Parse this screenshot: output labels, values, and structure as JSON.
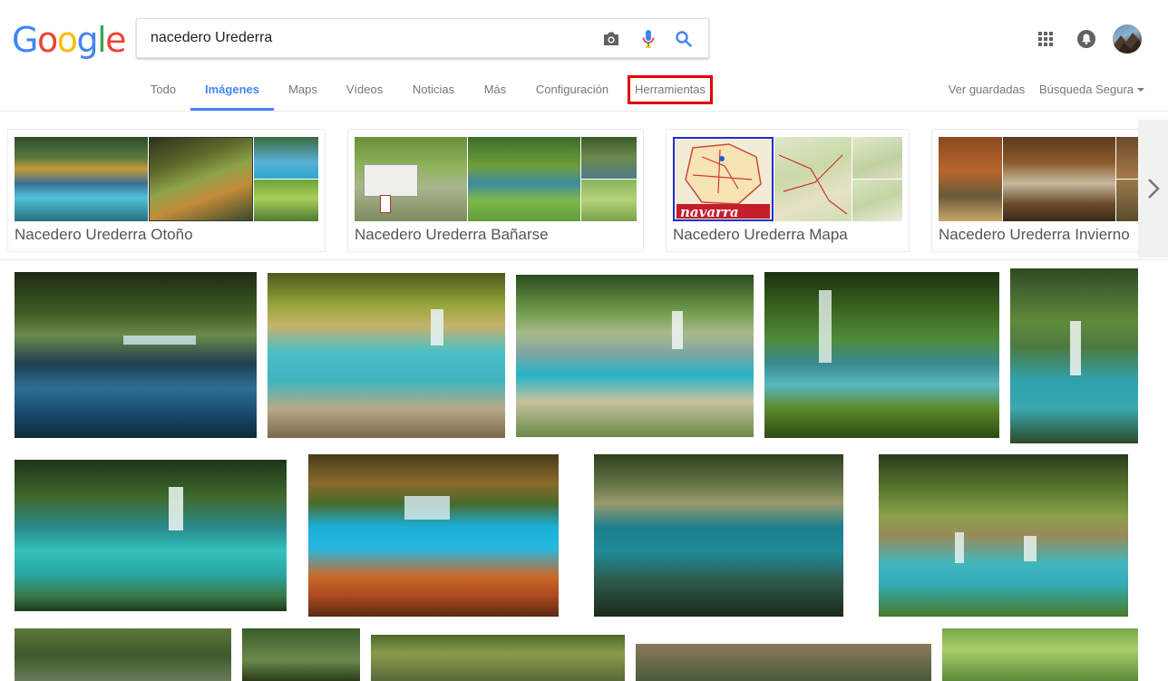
{
  "logo": {
    "letters": [
      "G",
      "o",
      "o",
      "g",
      "l",
      "e"
    ],
    "colors": [
      "#4285f4",
      "#ea4335",
      "#fbbc05",
      "#4285f4",
      "#34a853",
      "#ea4335"
    ]
  },
  "search": {
    "query": "nacedero Urederra"
  },
  "icons": {
    "camera": "camera-icon",
    "mic": "microphone-icon",
    "search": "search-icon",
    "apps": "apps-grid-icon",
    "notifications": "notifications-icon"
  },
  "tabs": {
    "all": "Todo",
    "images": "Imágenes",
    "maps": "Maps",
    "videos": "Vídeos",
    "news": "Noticias",
    "more": "Más",
    "settings": "Configuración",
    "tools": "Herramientas",
    "saved": "Ver guardadas",
    "safesearch": "Búsqueda Segura"
  },
  "related": [
    {
      "label": "Nacedero Urederra Otoño"
    },
    {
      "label": "Nacedero Urederra Bañarse"
    },
    {
      "label": "Nacedero Urederra Mapa"
    },
    {
      "label": "Nacedero Urederra Invierno"
    }
  ],
  "map_thumb_text": "navarra",
  "colors": {
    "accent": "#4285f4",
    "highlight": "#e30000"
  }
}
